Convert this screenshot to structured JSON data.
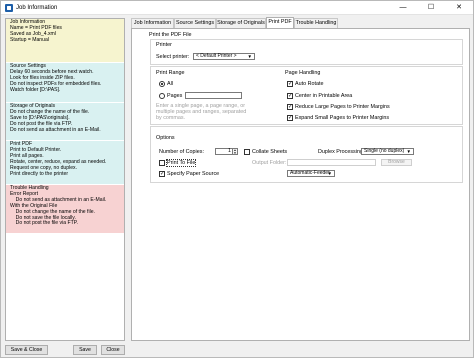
{
  "window": {
    "title": "Job Information",
    "controls": {
      "minimize": "—",
      "maximize": "☐",
      "close": "✕"
    }
  },
  "summary": {
    "job": "Job Information\nName = Print PDF files\nSaved as Job_4.xml\nStartup = Manual",
    "source": "Source Settings\nDelay 60 seconds before next watch.\nLook for files inside ZIP files.\nDo not inspect PDFs for embedded files.\nWatch folder [D:\\PAS].",
    "storage": "Storage of Originals\nDo not change the name of the file.\nSave to [D:\\PAS\\originals].\nDo not post the file via FTP.\nDo not send as attachment in an E-Mail.",
    "print": "Print PDF\nPrint to Default Printer.\nPrint all pages.\nRotate, center, reduce, expand as needed.\nRequest one copy, no duplex.\nPrint directly to the printer",
    "trouble": "Trouble Handling\nError Report\n    Do not send as attachment in an E-Mail.\nWith the Original File\n    Do not change the name of the file.\n    Do not save the file locally.\n    Do not post the file via FTP."
  },
  "buttons": {
    "save_close": "Save & Close",
    "save": "Save",
    "close": "Close"
  },
  "tabs": [
    "Job Information",
    "Source Settings",
    "Storage of Originals",
    "Print PDF",
    "Trouble Handling"
  ],
  "active_tab": "Print PDF",
  "print": {
    "heading": "Print the PDF File",
    "printer_group": "Printer",
    "select_printer_label": "Select printer:",
    "printer_value": "< Default Printer >",
    "range_group": "Print Range",
    "all_label": "All",
    "pages_label": "Pages",
    "pages_value": "",
    "range_hint": "Enter a single page, a page range, or\nmultiple pages and ranges, separated\nby commas.",
    "handling_group": "Page Handling",
    "auto_rotate": "Auto Rotate",
    "center": "Center in Printable Area",
    "reduce": "Reduce Large Pages to Printer Margins",
    "expand": "Expand Small Pages to Printer Margins",
    "options_group": "Options",
    "copies_label": "Number of Copies:",
    "copies_value": "1",
    "collate_label": "Collate Sheets",
    "duplex_label": "Duplex Processing:",
    "duplex_value": "Single (no duplex)",
    "print_to_file_label": "Print To File",
    "output_folder_label": "Output Folder:",
    "browse_label": "Browse",
    "paper_source_label": "Specify Paper Source",
    "paper_source_value": "Automatic-Feeder",
    "check_mark": "✓"
  }
}
